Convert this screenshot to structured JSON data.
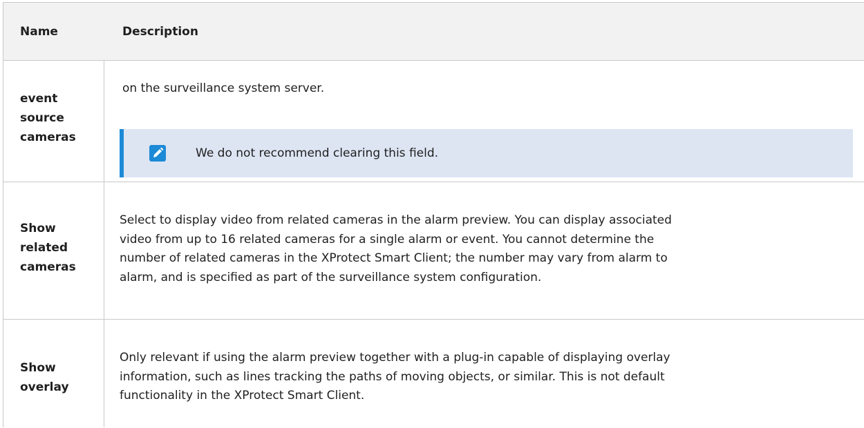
{
  "table": {
    "headers": {
      "name": "Name",
      "description": "Description"
    },
    "rows": [
      {
        "name_lines": [
          "event",
          "source",
          "cameras"
        ],
        "description": "on the surveillance system server.",
        "note": {
          "icon": "pencil-icon",
          "text": "We do not recommend clearing this field."
        }
      },
      {
        "name_lines": [
          "Show",
          "related",
          "cameras"
        ],
        "description_lines": [
          "Select to display video from related cameras in the alarm preview. You can display associated",
          "video from up to 16 related cameras for a single alarm or event. You cannot determine the",
          "number of related cameras in the XProtect Smart Client; the number may vary from alarm to",
          "alarm, and is specified as part of the surveillance system configuration."
        ]
      },
      {
        "name_lines": [
          "Show",
          "overlay"
        ],
        "description_lines": [
          "Only relevant if using the alarm preview together with a plug-in capable of displaying overlay",
          "information, such as lines tracking the paths of moving objects, or similar. This is not default",
          "functionality in the XProtect Smart Client."
        ]
      }
    ]
  },
  "colors": {
    "note_background": "#dde5f3",
    "note_accent": "#1c8ad6",
    "header_background": "#f2f2f2",
    "border": "#c8c8c8"
  }
}
